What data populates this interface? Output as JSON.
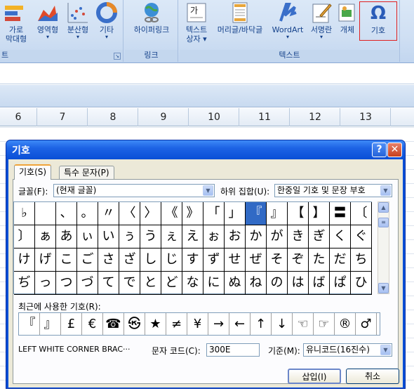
{
  "ribbon": {
    "groups": [
      {
        "label": "차트",
        "buttons": [
          {
            "label": "가로\n막대형",
            "icon": "bar-chart-icon"
          },
          {
            "label": "영역형",
            "icon": "area-chart-icon"
          },
          {
            "label": "분산형",
            "icon": "scatter-chart-icon"
          },
          {
            "label": "기타",
            "icon": "other-chart-icon"
          }
        ]
      },
      {
        "label": "링크",
        "buttons": [
          {
            "label": "하이퍼링크",
            "icon": "hyperlink-icon"
          }
        ]
      },
      {
        "label": "텍스트",
        "buttons": [
          {
            "label": "텍스트\n상자",
            "icon": "textbox-icon"
          },
          {
            "label": "머리글/바닥글",
            "icon": "header-footer-icon"
          },
          {
            "label": "WordArt",
            "icon": "wordart-icon"
          },
          {
            "label": "서명란",
            "icon": "signature-icon"
          },
          {
            "label": "개체",
            "icon": "object-icon"
          },
          {
            "label": "기호",
            "icon": "omega-icon"
          }
        ]
      }
    ],
    "chart_label_visible": "트",
    "bar_label_line1": "가로",
    "bar_label_line2": "막대형",
    "area_label": "영역형",
    "scatter_label": "분산형",
    "other_label": "기타",
    "hyperlink_label": "하이퍼링크",
    "link_group_label": "링크",
    "textbox_line1": "텍스트",
    "textbox_line2": "상자",
    "header_footer_label": "머리글/바닥글",
    "wordart_label": "WordArt",
    "signature_label": "서명란",
    "object_label": "개체",
    "symbol_label": "기호",
    "text_group_label": "텍스트",
    "omega_glyph": "Ω"
  },
  "columns": [
    "6",
    "7",
    "8",
    "9",
    "10",
    "11",
    "12",
    "13"
  ],
  "dialog": {
    "title": "기호",
    "help": "?",
    "close": "✕",
    "tabs": {
      "symbols": "기호(S)",
      "special": "특수 문자(P)"
    },
    "font_label": "글꼴(F):",
    "font_value": "(현재 글꼴)",
    "subset_label": "하위 집합(U):",
    "subset_value": "한중일 기호 및 문장 부호",
    "symbols": [
      [
        "♭",
        "",
        "、",
        "。",
        "〃",
        "〈",
        "〉",
        "《",
        "》",
        "「",
        "」",
        "『",
        "』",
        "【",
        "】",
        "〓",
        "〔"
      ],
      [
        "〕",
        "ぁ",
        "あ",
        "ぃ",
        "い",
        "ぅ",
        "う",
        "ぇ",
        "え",
        "ぉ",
        "お",
        "か",
        "が",
        "き",
        "ぎ",
        "く",
        "ぐ"
      ],
      [
        "け",
        "げ",
        "こ",
        "ご",
        "さ",
        "ざ",
        "し",
        "じ",
        "す",
        "ず",
        "せ",
        "ぜ",
        "そ",
        "ぞ",
        "た",
        "だ",
        "ち"
      ],
      [
        "ぢ",
        "っ",
        "つ",
        "づ",
        "て",
        "で",
        "と",
        "ど",
        "な",
        "に",
        "ぬ",
        "ね",
        "の",
        "は",
        "ば",
        "ぱ",
        "ひ"
      ]
    ],
    "selected_symbol": "『",
    "recent_label": "최근에 사용한 기호(R):",
    "recent": [
      "『",
      "』",
      "£",
      "€",
      "☎",
      "㉿",
      "★",
      "≠",
      "¥",
      "→",
      "←",
      "↑",
      "↓",
      "☜",
      "☞",
      "®",
      "♂"
    ],
    "char_name": "LEFT WHITE CORNER BRAC···",
    "code_label": "문자 코드(C):",
    "code_value": "300E",
    "basis_label": "기준(M):",
    "basis_value": "유니코드(16진수)",
    "insert_button": "삽입(I)",
    "cancel_button": "취소"
  }
}
